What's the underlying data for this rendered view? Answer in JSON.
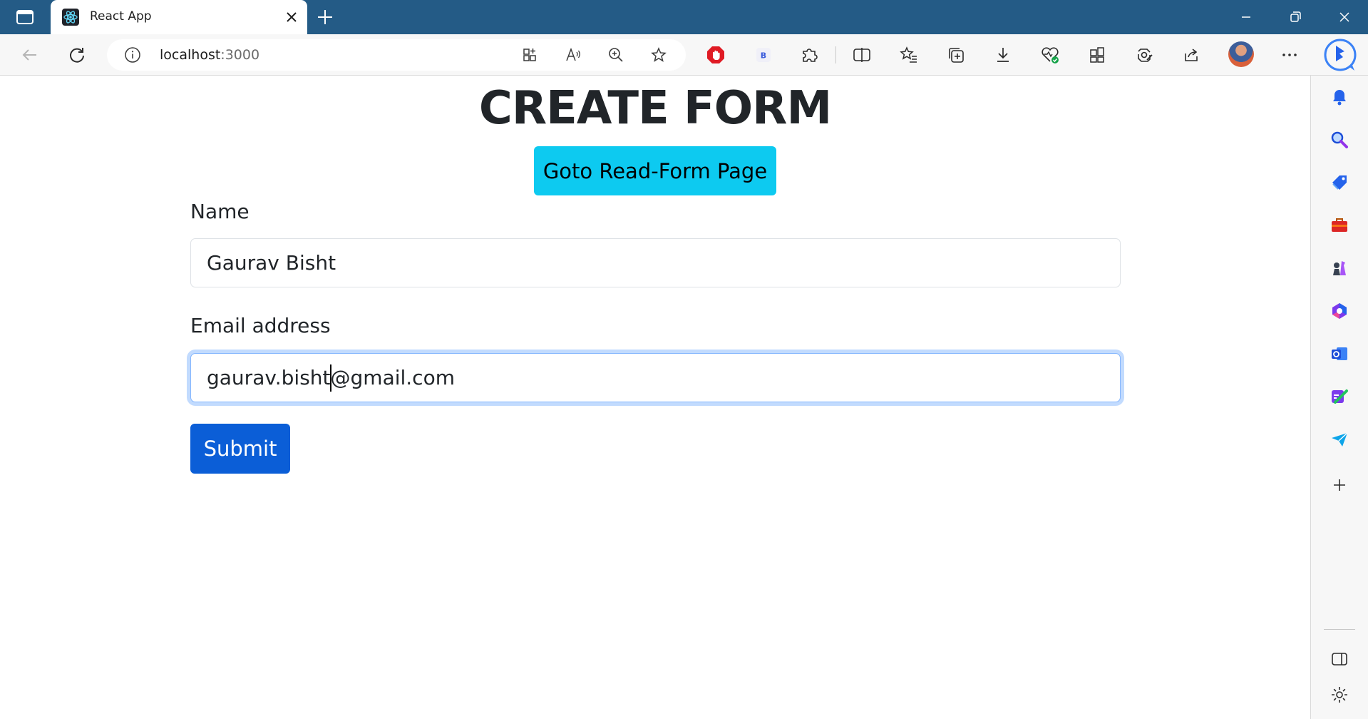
{
  "browser": {
    "tab_title": "React App",
    "url_host": "localhost",
    "url_port": ":3000",
    "accent_color": "#245b86"
  },
  "toolbar_icons": [
    "back-arrow-icon",
    "refresh-icon",
    "site-info-icon",
    "app-available-icon",
    "read-aloud-icon",
    "zoom-icon",
    "favorite-star-icon",
    "adblock-icon",
    "extension-b-icon",
    "extensions-puzzle-icon",
    "split-screen-icon",
    "favorites-icon",
    "collections-icon",
    "downloads-icon",
    "browser-essentials-icon",
    "workspaces-icon",
    "screenshot-icon",
    "share-icon",
    "profile-avatar",
    "more-menu-icon",
    "bing-copilot-icon"
  ],
  "sidebar_icons": [
    "notifications-bell-icon",
    "search-magnifier-icon",
    "shopping-tag-icon",
    "tools-briefcase-icon",
    "games-chess-icon",
    "office-icon",
    "outlook-icon",
    "designer-icon",
    "telegram-send-icon",
    "add-icon",
    "sidebar-toggle-icon",
    "settings-gear-icon"
  ],
  "page": {
    "heading": "CREATE FORM",
    "goto_button": "Goto Read-Form Page",
    "name_label": "Name",
    "name_value": "Gaurav Bisht",
    "email_label": "Email address",
    "email_value_before_caret": "gaurav.bisht",
    "email_value_after_caret": "@gmail.com",
    "submit_button": "Submit",
    "colors": {
      "info_button": "#0dcaf0",
      "primary_button": "#0b5ed7",
      "text": "#212529"
    }
  }
}
